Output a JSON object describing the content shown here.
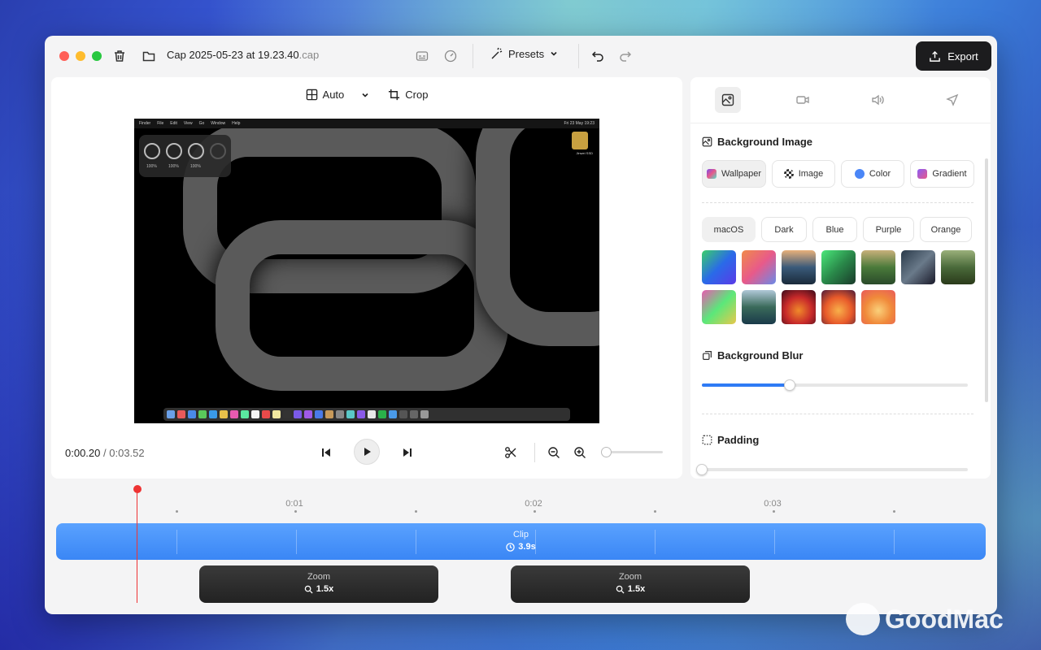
{
  "window": {
    "file_name": "Cap 2025-05-23 at 19.23.40",
    "file_ext": ".cap",
    "presets_label": "Presets",
    "export_label": "Export"
  },
  "editor": {
    "aspect_label": "Auto",
    "crop_label": "Crop",
    "current_time": "0:00.20",
    "separator": "/",
    "total_time": "0:03.52"
  },
  "preview": {
    "menu_items": [
      "Finder",
      "File",
      "Edit",
      "View",
      "Go",
      "Window",
      "Help"
    ],
    "clock": "Fri 23 May 19:23",
    "battery_labels": [
      "100%",
      "100%",
      "100%"
    ],
    "drive_label": "Jinwei SSD"
  },
  "sidebar": {
    "background_title": "Background Image",
    "source_tabs": [
      {
        "label": "Wallpaper",
        "color": "#8a5cf6",
        "active": true
      },
      {
        "label": "Image",
        "color": "#333333",
        "active": false
      },
      {
        "label": "Color",
        "color": "#4a86f7",
        "active": false
      },
      {
        "label": "Gradient",
        "color": "#d0508a",
        "active": false
      }
    ],
    "categories": [
      "macOS",
      "Dark",
      "Blue",
      "Purple",
      "Orange"
    ],
    "blur_title": "Background Blur",
    "blur_value": 0.33,
    "padding_title": "Padding",
    "padding_value": 0.0
  },
  "timeline": {
    "ticks": [
      "0:01",
      "0:02",
      "0:03"
    ],
    "clip_label": "Clip",
    "clip_duration": "3.9s",
    "zooms": [
      {
        "label": "Zoom",
        "value": "1.5x"
      },
      {
        "label": "Zoom",
        "value": "1.5x"
      }
    ]
  },
  "watermark": "GoodMac"
}
